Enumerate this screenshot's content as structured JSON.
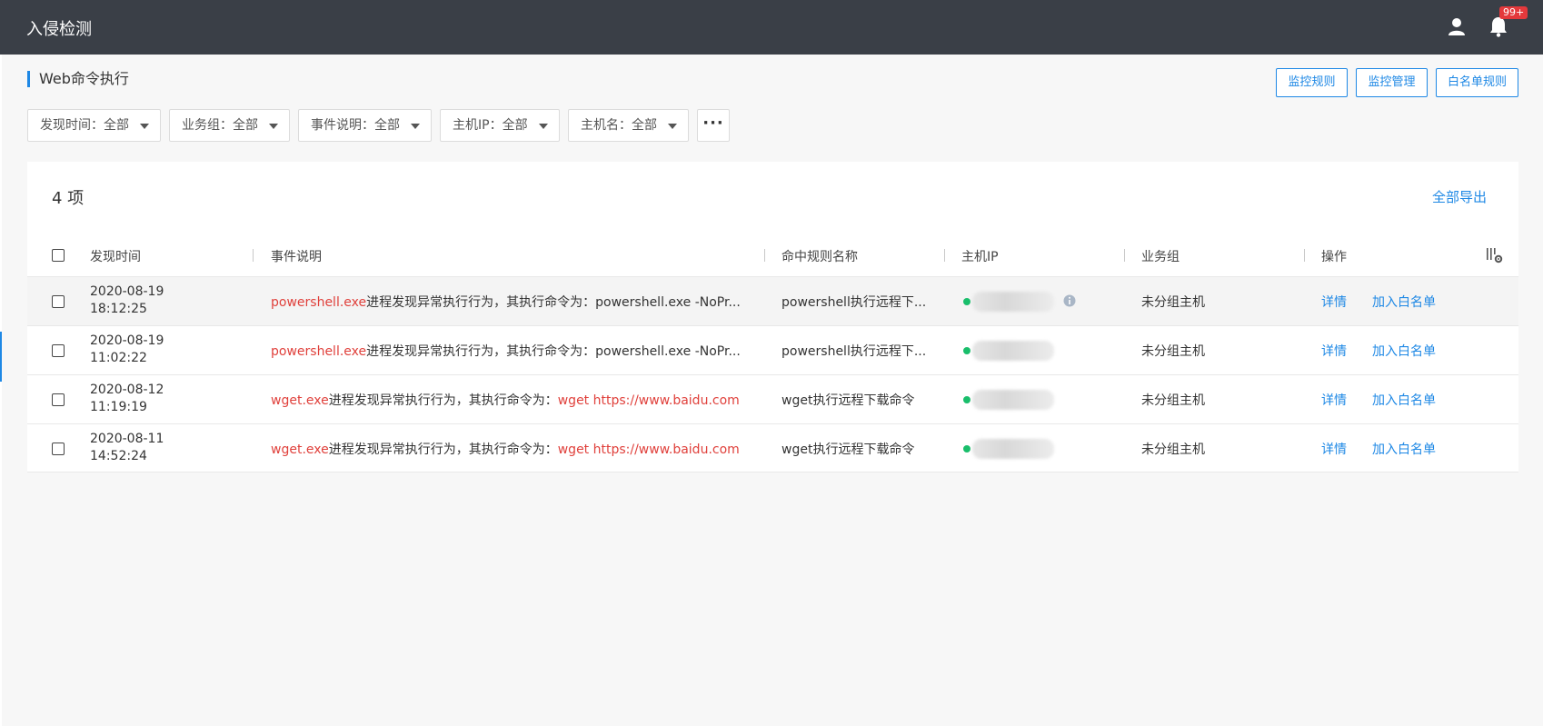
{
  "header": {
    "app_title": "入侵检测",
    "notification_badge": "99+",
    "user_icon": "user-icon",
    "bell_icon": "bell-icon"
  },
  "page": {
    "title": "Web命令执行"
  },
  "actions": {
    "monitor_rules": "监控规则",
    "monitor_management": "监控管理",
    "whitelist_rules": "白名单规则"
  },
  "filters": {
    "discover_time": "发现时间：全部",
    "business_group": "业务组：全部",
    "event_desc": "事件说明：全部",
    "host_ip": "主机IP：全部",
    "host_name": "主机名：全部",
    "more": "···"
  },
  "table": {
    "count_label": "4 项",
    "export_all": "全部导出",
    "columns": {
      "time": "发现时间",
      "desc": "事件说明",
      "rule": "命中规则名称",
      "ip": "主机IP",
      "group": "业务组",
      "ops": "操作"
    },
    "rows": [
      {
        "date": "2020-08-19",
        "time": "18:12:25",
        "proc": "powershell.exe",
        "desc_mid": "进程发现异常执行行为，其执行命令为：",
        "cmd_black": "powershell.exe -NoPr...",
        "cmd_red": "",
        "rule": "powershell执行远程下...",
        "group": "未分组主机",
        "detail": "详情",
        "whitelist": "加入白名单"
      },
      {
        "date": "2020-08-19",
        "time": "11:02:22",
        "proc": "powershell.exe",
        "desc_mid": "进程发现异常执行行为，其执行命令为：",
        "cmd_black": "powershell.exe -NoPr...",
        "cmd_red": "",
        "rule": "powershell执行远程下...",
        "group": "未分组主机",
        "detail": "详情",
        "whitelist": "加入白名单"
      },
      {
        "date": "2020-08-12",
        "time": "11:19:19",
        "proc": "wget.exe",
        "desc_mid": "进程发现异常执行行为，其执行命令为：",
        "cmd_black": "",
        "cmd_red": "wget https://www.baidu.com",
        "rule": "wget执行远程下载命令",
        "group": "未分组主机",
        "detail": "详情",
        "whitelist": "加入白名单"
      },
      {
        "date": "2020-08-11",
        "time": "14:52:24",
        "proc": "wget.exe",
        "desc_mid": "进程发现异常执行行为，其执行命令为：",
        "cmd_black": "",
        "cmd_red": "wget https://www.baidu.com",
        "rule": "wget执行远程下载命令",
        "group": "未分组主机",
        "detail": "详情",
        "whitelist": "加入白名单"
      }
    ]
  },
  "colors": {
    "accent": "#1e88e5",
    "danger": "#e0413c",
    "online": "#19be6b",
    "topbar": "#3a3f47"
  }
}
